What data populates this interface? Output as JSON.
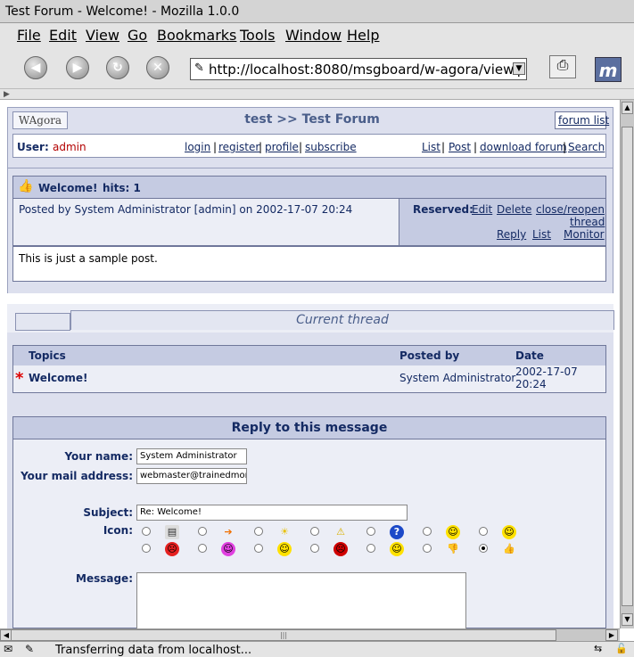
{
  "window": {
    "title": "Test Forum - Welcome! - Mozilla 1.0.0"
  },
  "menu": [
    "File",
    "Edit",
    "View",
    "Go",
    "Bookmarks",
    "Tools",
    "Window",
    "Help"
  ],
  "nav": {
    "url": "http://localhost:8080/msgboard/w-agora/view.p",
    "logo_text": "m"
  },
  "forum": {
    "logo": "WAgora",
    "breadcrumb": "test >> Test Forum",
    "forum_list": "forum list",
    "user_label": "User:",
    "user_name": "admin",
    "center_links": [
      "login",
      "register",
      "profile",
      "subscribe"
    ],
    "right_links": [
      "List",
      "Post",
      "download forum",
      "Search"
    ]
  },
  "post": {
    "title": "Welcome!",
    "hits": "hits: 1",
    "posted_by": "Posted by System Administrator [admin] on 2002-17-07 20:24",
    "reserved_label": "Reserved:",
    "actions": [
      "Edit",
      "Delete",
      "close/reopen",
      "thread",
      "Reply",
      "List",
      "Monitor"
    ],
    "body": "This is just a sample post."
  },
  "thread": {
    "title": "Current thread",
    "columns": [
      "Topics",
      "Posted by",
      "Date"
    ],
    "rows": [
      {
        "topic": "Welcome!",
        "posted_by": "System Administrator",
        "date_line1": "2002-17-07",
        "date_line2": "20:24"
      }
    ]
  },
  "reply": {
    "title": "Reply to this message",
    "name_label": "Your name:",
    "name_value": "System Administrator",
    "mail_label": "Your mail address:",
    "mail_value": "webmaster@trainedmonke",
    "subject_label": "Subject:",
    "subject_value": "Re: Welcome!",
    "icon_label": "Icon:",
    "message_label": "Message:"
  },
  "status": {
    "text": "Transferring data from localhost..."
  },
  "colors": {
    "link": "#142a63",
    "user": "#b30000",
    "panel": "#eceef6",
    "header": "#c5cbe2"
  }
}
